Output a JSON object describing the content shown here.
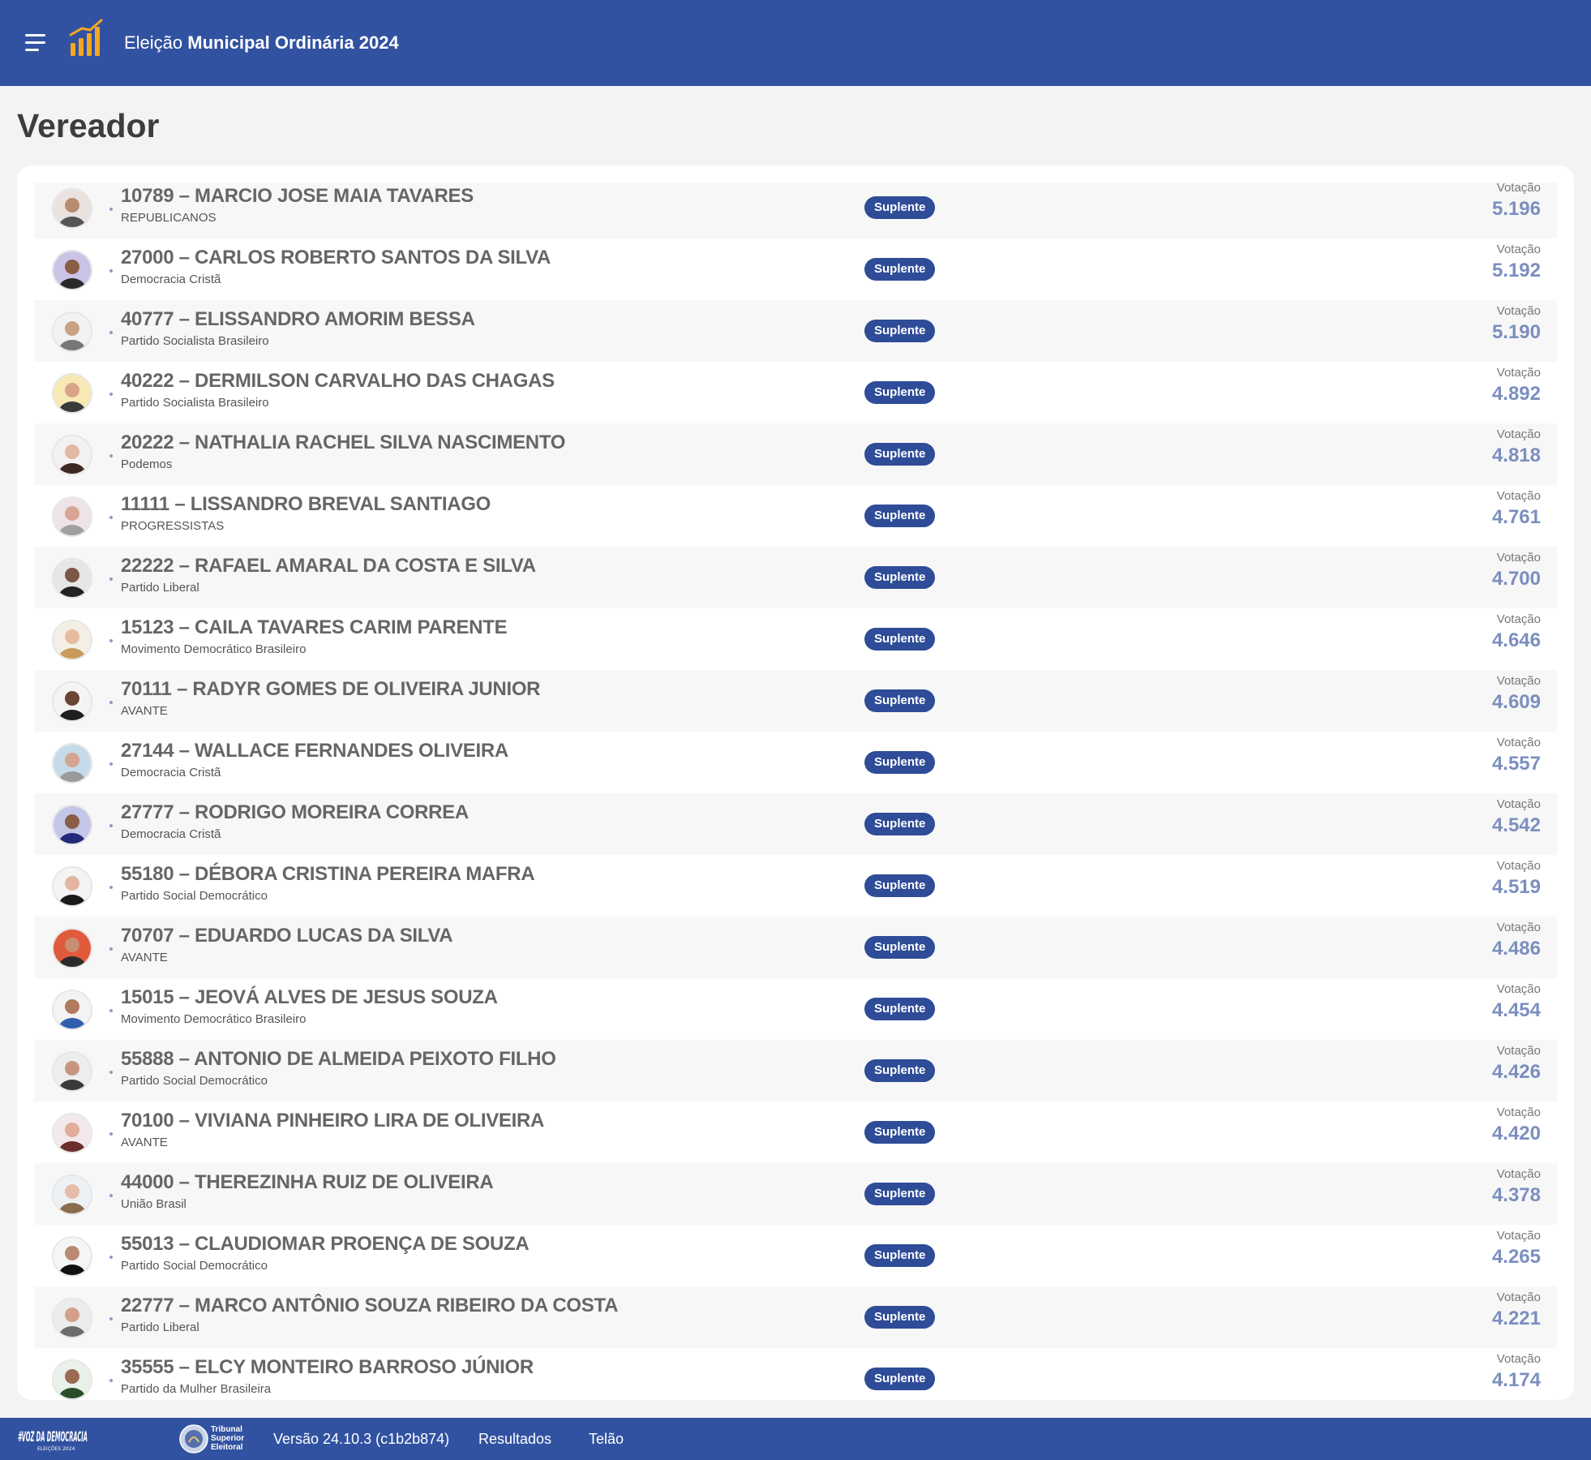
{
  "header": {
    "title_prefix": "Eleição",
    "title_bold": "Municipal Ordinária 2024",
    "brand_color": "#3152a0",
    "accent_color": "#f5a623",
    "menu_icon": "hamburger-menu-icon",
    "logo_icon": "bar-chart-icon"
  },
  "page": {
    "title": "Vereador"
  },
  "candidates": [
    {
      "number": "10789",
      "name": "MARCIO JOSE MAIA TAVARES",
      "party": "REPUBLICANOS",
      "status": "Suplente",
      "vote_label": "Votação",
      "votes": "5.196",
      "photo": [
        "#e9e2de",
        "#b98c72",
        "#555555"
      ]
    },
    {
      "number": "27000",
      "name": "CARLOS ROBERTO SANTOS DA SILVA",
      "party": "Democracia Cristã",
      "status": "Suplente",
      "vote_label": "Votação",
      "votes": "5.192",
      "photo": [
        "#cbc3e6",
        "#8a5e45",
        "#2a2a2a"
      ]
    },
    {
      "number": "40777",
      "name": "ELISSANDRO AMORIM BESSA",
      "party": "Partido Socialista Brasileiro",
      "status": "Suplente",
      "vote_label": "Votação",
      "votes": "5.190",
      "photo": [
        "#f2f2f2",
        "#c9a283",
        "#777777"
      ]
    },
    {
      "number": "40222",
      "name": "DERMILSON CARVALHO DAS CHAGAS",
      "party": "Partido Socialista Brasileiro",
      "status": "Suplente",
      "vote_label": "Votação",
      "votes": "4.892",
      "photo": [
        "#f7e9b3",
        "#d8a488",
        "#3b3b3b"
      ]
    },
    {
      "number": "20222",
      "name": "NATHALIA RACHEL SILVA NASCIMENTO",
      "party": "Podemos",
      "status": "Suplente",
      "vote_label": "Votação",
      "votes": "4.818",
      "photo": [
        "#f4f1f3",
        "#e1b9a2",
        "#3c2a22"
      ]
    },
    {
      "number": "11111",
      "name": "LISSANDRO BREVAL SANTIAGO",
      "party": "PROGRESSISTAS",
      "status": "Suplente",
      "vote_label": "Votação",
      "votes": "4.761",
      "photo": [
        "#efe3ea",
        "#d8a595",
        "#a0a0a0"
      ]
    },
    {
      "number": "22222",
      "name": "RAFAEL AMARAL DA COSTA E SILVA",
      "party": "Partido Liberal",
      "status": "Suplente",
      "vote_label": "Votação",
      "votes": "4.700",
      "photo": [
        "#e6e6e6",
        "#7a5747",
        "#222222"
      ]
    },
    {
      "number": "15123",
      "name": "CAILA TAVARES CARIM PARENTE",
      "party": "Movimento Democrático Brasileiro",
      "status": "Suplente",
      "vote_label": "Votação",
      "votes": "4.646",
      "photo": [
        "#f3efe6",
        "#e6bb9e",
        "#c99a5a"
      ]
    },
    {
      "number": "70111",
      "name": "RADYR GOMES DE OLIVEIRA JUNIOR",
      "party": "AVANTE",
      "status": "Suplente",
      "vote_label": "Votação",
      "votes": "4.609",
      "photo": [
        "#f4f4f4",
        "#6b4434",
        "#1e1e1e"
      ]
    },
    {
      "number": "27144",
      "name": "WALLACE FERNANDES OLIVEIRA",
      "party": "Democracia Cristã",
      "status": "Suplente",
      "vote_label": "Votação",
      "votes": "4.557",
      "photo": [
        "#c6dbe9",
        "#d4a590",
        "#9a9a9a"
      ]
    },
    {
      "number": "27777",
      "name": "RODRIGO MOREIRA CORREA",
      "party": "Democracia Cristã",
      "status": "Suplente",
      "vote_label": "Votação",
      "votes": "4.542",
      "photo": [
        "#c4c6e8",
        "#8b5e48",
        "#232a7a"
      ]
    },
    {
      "number": "55180",
      "name": "DÉBORA CRISTINA PEREIRA MAFRA",
      "party": "Partido Social Democrático",
      "status": "Suplente",
      "vote_label": "Votação",
      "votes": "4.519",
      "photo": [
        "#f4f4f4",
        "#e2b6a0",
        "#1a1a1a"
      ]
    },
    {
      "number": "70707",
      "name": "EDUARDO LUCAS DA SILVA",
      "party": "AVANTE",
      "status": "Suplente",
      "vote_label": "Votação",
      "votes": "4.486",
      "photo": [
        "#e25a3c",
        "#c98e74",
        "#2b2b2b"
      ]
    },
    {
      "number": "15015",
      "name": "JEOVÁ ALVES DE JESUS SOUZA",
      "party": "Movimento Democrático Brasileiro",
      "status": "Suplente",
      "vote_label": "Votação",
      "votes": "4.454",
      "photo": [
        "#f3f3f3",
        "#b07a5e",
        "#2f5fae"
      ]
    },
    {
      "number": "55888",
      "name": "ANTONIO DE ALMEIDA PEIXOTO FILHO",
      "party": "Partido Social Democrático",
      "status": "Suplente",
      "vote_label": "Votação",
      "votes": "4.426",
      "photo": [
        "#ededed",
        "#c69580",
        "#3a3a3a"
      ]
    },
    {
      "number": "70100",
      "name": "VIVIANA PINHEIRO LIRA DE OLIVEIRA",
      "party": "AVANTE",
      "status": "Suplente",
      "vote_label": "Votação",
      "votes": "4.420",
      "photo": [
        "#f3e8ea",
        "#e0ae9b",
        "#6b2f2a"
      ]
    },
    {
      "number": "44000",
      "name": "THEREZINHA RUIZ DE OLIVEIRA",
      "party": "União Brasil",
      "status": "Suplente",
      "vote_label": "Votação",
      "votes": "4.378",
      "photo": [
        "#eef1f4",
        "#e3bda8",
        "#8a6b4c"
      ]
    },
    {
      "number": "55013",
      "name": "CLAUDIOMAR PROENÇA DE SOUZA",
      "party": "Partido Social Democrático",
      "status": "Suplente",
      "vote_label": "Votação",
      "votes": "4.265",
      "photo": [
        "#f5f5f5",
        "#b98a70",
        "#111111"
      ]
    },
    {
      "number": "22777",
      "name": "MARCO ANTÔNIO SOUZA RIBEIRO DA COSTA",
      "party": "Partido Liberal",
      "status": "Suplente",
      "vote_label": "Votação",
      "votes": "4.221",
      "photo": [
        "#ececec",
        "#d3a08c",
        "#6c6c6c"
      ]
    },
    {
      "number": "35555",
      "name": "ELCY MONTEIRO BARROSO JÚNIOR",
      "party": "Partido da Mulher Brasileira",
      "status": "Suplente",
      "vote_label": "Votação",
      "votes": "4.174",
      "photo": [
        "#eaf0ea",
        "#9a6a52",
        "#2b4d2b"
      ]
    }
  ],
  "footer": {
    "campaign_logo": "voz-da-democracia-logo",
    "campaign_text": "#VOZ DA DEMOCRACIA",
    "campaign_sub": "ELEIÇÕES 2024",
    "tse_seal": "tse-seal-icon",
    "tse_line1": "Tribunal",
    "tse_line2": "Superior",
    "tse_line3": "Eleitoral",
    "version": "Versão 24.10.3 (c1b2b874)",
    "link_results": "Resultados",
    "link_screen": "Telão"
  }
}
